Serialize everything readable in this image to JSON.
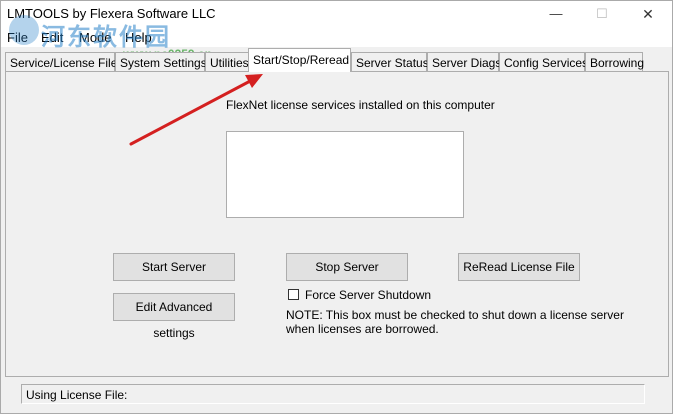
{
  "window": {
    "title": "LMTOOLS by Flexera Software LLC",
    "controls": {
      "minimize": "—",
      "maximize": "☐",
      "close": "✕"
    }
  },
  "menu": [
    "File",
    "Edit",
    "Mode",
    "Help"
  ],
  "watermark": {
    "text": "河东软件园",
    "url": "www.pc0359.cn"
  },
  "tabs": [
    {
      "label": "Service/License File",
      "active": false
    },
    {
      "label": "System Settings",
      "active": false
    },
    {
      "label": "Utilities",
      "active": false
    },
    {
      "label": "Start/Stop/Reread",
      "active": true
    },
    {
      "label": "Server Status",
      "active": false
    },
    {
      "label": "Server Diags",
      "active": false
    },
    {
      "label": "Config Services",
      "active": false
    },
    {
      "label": "Borrowing",
      "active": false
    }
  ],
  "panel": {
    "installed_label": "FlexNet license services installed on this computer",
    "start_server": "Start Server",
    "stop_server": "Stop Server",
    "reread_license": "ReRead License File",
    "edit_advanced": "Edit Advanced settings",
    "force_shutdown_label": "Force Server Shutdown",
    "force_shutdown_checked": false,
    "note_line1": "NOTE:  This box must be checked to shut down a license server",
    "note_line2": "when licenses are borrowed."
  },
  "status": {
    "text": "Using License File:"
  },
  "colors": {
    "arrow": "#d42020",
    "watermark": "#2882c8"
  }
}
